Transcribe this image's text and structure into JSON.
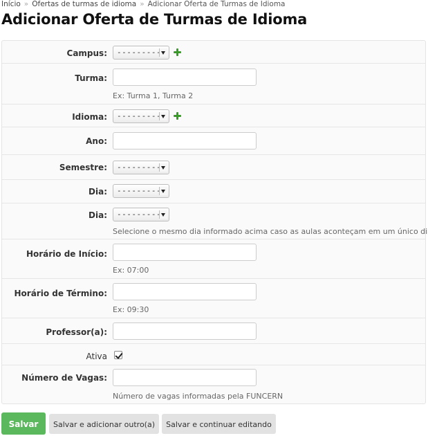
{
  "breadcrumbs": [
    "Início",
    "Ofertas de turmas de idioma",
    "Adicionar Oferta de Turmas de Idioma"
  ],
  "breadcrumb_separator": "»",
  "page_title": "Adicionar Oferta de Turmas de Idioma",
  "fields": {
    "campus": {
      "label": "Campus:",
      "value": "---------"
    },
    "turma": {
      "label": "Turma:",
      "value": "",
      "help": "Ex: Turma 1, Turma 2"
    },
    "idioma": {
      "label": "Idioma:",
      "value": "---------"
    },
    "ano": {
      "label": "Ano:",
      "value": ""
    },
    "semestre": {
      "label": "Semestre:",
      "value": "---------"
    },
    "dia1": {
      "label": "Dia:",
      "value": "---------"
    },
    "dia2": {
      "label": "Dia:",
      "value": "---------",
      "help": "Selecione o mesmo dia informado acima caso as aulas aconteçam em um único dia"
    },
    "horario_inicio": {
      "label": "Horário de Início:",
      "value": "",
      "help": "Ex: 07:00"
    },
    "horario_termino": {
      "label": "Horário de Término:",
      "value": "",
      "help": "Ex: 09:30"
    },
    "professor": {
      "label": "Professor(a):",
      "value": ""
    },
    "ativa": {
      "label": "Ativa",
      "checked": true
    },
    "numero_vagas": {
      "label": "Número de Vagas:",
      "value": "",
      "help": "Número de vagas informadas pela FUNCERN"
    }
  },
  "buttons": {
    "save": "Salvar",
    "save_add_another": "Salvar e adicionar outro(a)",
    "save_continue": "Salvar e continuar editando"
  },
  "colors": {
    "primary_button": "#5cb85c",
    "add_icon": "#3a9a2a"
  }
}
